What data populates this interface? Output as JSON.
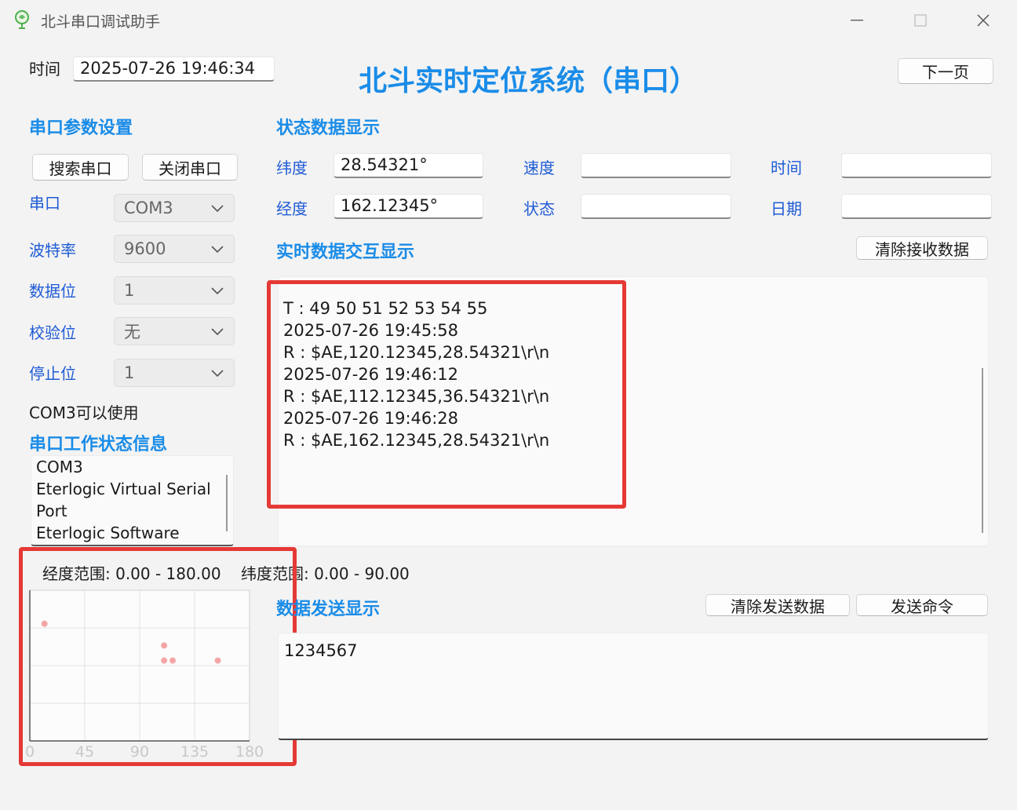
{
  "window": {
    "title": "北斗串口调试助手"
  },
  "header": {
    "time_label": "时间",
    "time_value": "2025-07-26 19:46:34",
    "main_title": "北斗实时定位系统（串口）",
    "next_page": "下一页"
  },
  "serial_settings": {
    "section_title": "串口参数设置",
    "search_button": "搜索串口",
    "close_button": "关闭串口",
    "port_label": "串口",
    "port_value": "COM3",
    "baud_label": "波特率",
    "baud_value": "9600",
    "databits_label": "数据位",
    "databits_value": "1",
    "parity_label": "校验位",
    "parity_value": "无",
    "stopbits_label": "停止位",
    "stopbits_value": "1",
    "status_text": "COM3可以使用"
  },
  "port_info": {
    "section_title": "串口工作状态信息",
    "lines": [
      "COM3",
      "Eterlogic Virtual Serial",
      "Port",
      "Eterlogic Software"
    ]
  },
  "status_display": {
    "section_title": "状态数据显示",
    "lat_label": "纬度",
    "lat_value": "28.54321°",
    "lon_label": "经度",
    "lon_value": "162.12345°",
    "speed_label": "速度",
    "speed_value": "",
    "state_label": "状态",
    "state_value": "",
    "time_label": "时间",
    "time_value": "",
    "date_label": "日期",
    "date_value": ""
  },
  "realtime": {
    "section_title": "实时数据交互显示",
    "clear_button": "清除接收数据",
    "lines": [
      "T : 49 50 51 52 53 54 55",
      "2025-07-26 19:45:58",
      "R : $AE,120.12345,28.54321\\r\\n",
      "",
      "2025-07-26 19:46:12",
      "R : $AE,112.12345,36.54321\\r\\n",
      "",
      "2025-07-26 19:46:28",
      "R : $AE,162.12345,28.54321\\r\\n"
    ]
  },
  "send": {
    "section_title": "数据发送显示",
    "clear_button": "清除发送数据",
    "send_button": "发送命令",
    "text": "1234567"
  },
  "plot": {
    "range_text": "经度范围: 0.00 - 180.00    纬度范围: 0.00 - 90.00"
  },
  "chart_data": {
    "type": "scatter",
    "xlim": [
      0,
      180
    ],
    "ylim": [
      0,
      90
    ],
    "x_ticks": [
      "0",
      "45",
      "90",
      "135",
      "180"
    ],
    "grid": true,
    "point_color": "#f4a6a6",
    "points": [
      {
        "x": 12,
        "y": 70
      },
      {
        "x": 110,
        "y": 57
      },
      {
        "x": 110,
        "y": 48
      },
      {
        "x": 117,
        "y": 48
      },
      {
        "x": 154,
        "y": 48
      }
    ]
  },
  "colors": {
    "section": "#1a8ce8",
    "title": "#1a8ce8",
    "label": "#1f5bd6",
    "highlight": "#e53935"
  }
}
